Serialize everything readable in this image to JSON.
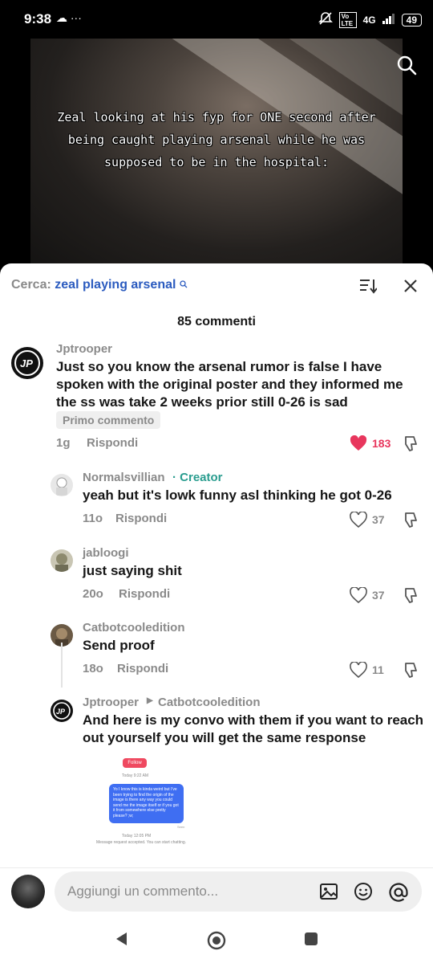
{
  "status": {
    "time": "9:38",
    "left_icons": "☁ ···",
    "network": "4G",
    "volte": "Vo LTE",
    "battery": "49"
  },
  "video": {
    "caption": "Zeal looking at his fyp for ONE second after being caught playing arsenal while he was supposed to be in the hospital:"
  },
  "search": {
    "prefix": "Cerca:",
    "term": "zeal playing arsenal"
  },
  "comments_count": "85 commenti",
  "comments": [
    {
      "user": "Jptrooper",
      "text": "Just so you know the arsenal rumor is false I have spoken with the original poster and they informed me the ss was take 2 weeks prior still 0-26 is sad",
      "badge": "Primo commento",
      "age": "1g",
      "reply": "Rispondi",
      "likes": "183"
    },
    {
      "user": "Normalsvillian",
      "creator_tag": "· Creator",
      "text": "yeah but it's lowk funny asl thinking he got 0-26",
      "age": "11o",
      "reply": "Rispondi",
      "likes": "37"
    },
    {
      "user": "jabloogi",
      "text": "just saying shit",
      "age": "20o",
      "reply": "Rispondi",
      "likes": "37"
    },
    {
      "user": "Catbotcooledition",
      "text": "Send proof",
      "age": "18o",
      "reply": "Rispondi",
      "likes": "11"
    },
    {
      "user": "Jptrooper",
      "reply_to": "Catbotcooledition",
      "text": "And here is my convo with them if you want to reach out yourself you will get the same response"
    }
  ],
  "dm_screenshot": {
    "follow": "Follow",
    "time1": "Today 9:22 AM",
    "message": "Yo I know this is kinda weird but I've been trying to find the origin of the image is there any way you could send me the image itself or if you got it from somewhere else pretty please? ;w;",
    "seen": "Seen",
    "time2": "Today 12:05 PM",
    "note": "Message request accepted. You can start chatting."
  },
  "footer": {
    "placeholder": "Aggiungi un commento..."
  },
  "colors": {
    "accent": "#2b5bbf",
    "like": "#e8365d",
    "creator": "#2a9d8f",
    "muted": "#8a8a8a"
  },
  "icons": [
    "search-icon",
    "sort-icon",
    "close-icon",
    "heart-icon",
    "dislike-icon",
    "image-icon",
    "emoji-icon",
    "mention-icon",
    "back-icon",
    "home-icon",
    "recents-icon"
  ]
}
